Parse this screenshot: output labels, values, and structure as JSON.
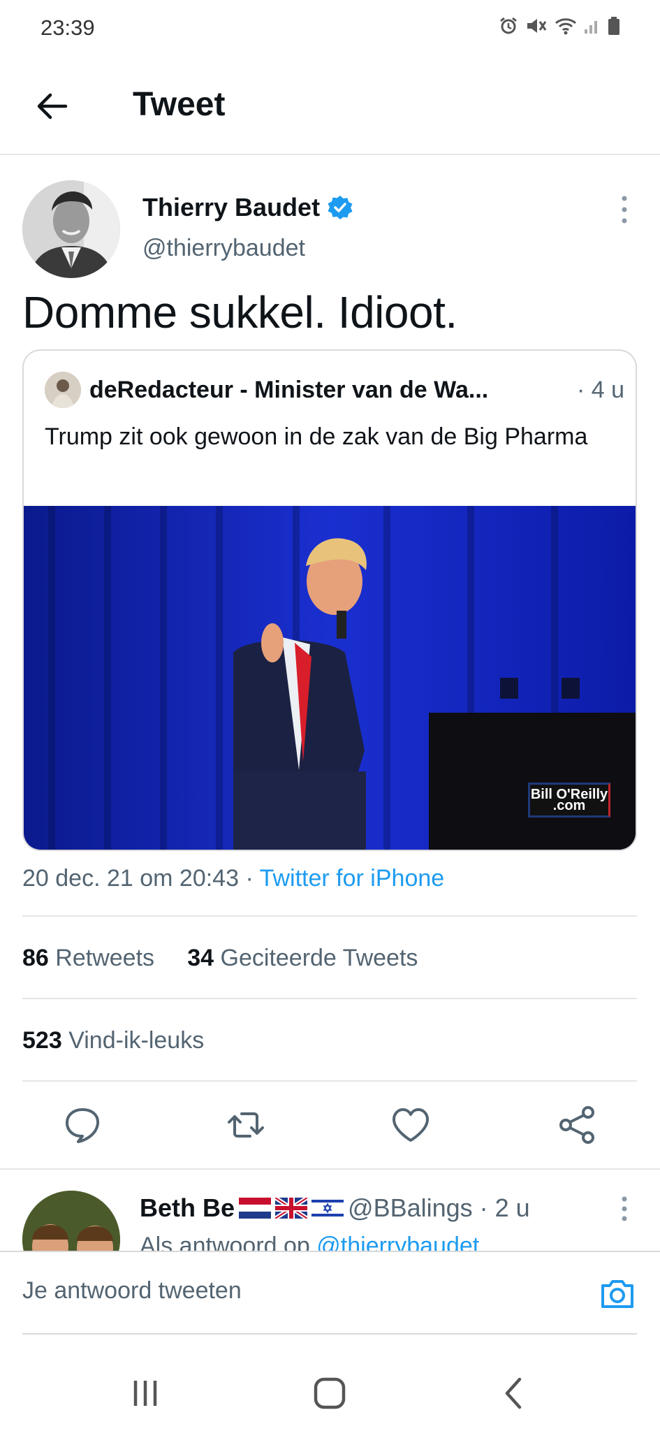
{
  "status_bar": {
    "time": "23:39"
  },
  "header": {
    "title": "Tweet"
  },
  "tweet": {
    "author_name": "Thierry Baudet",
    "author_handle": "@thierrybaudet",
    "text": "Domme sukkel. Idioot.",
    "quote": {
      "author": "deRedacteur - Minister van de Wa...",
      "time": "· 4 u",
      "text": "Trump zit ook gewoon in de zak van de Big Pharma",
      "watermark": "Bill O'Reilly .com"
    },
    "timestamp": "20 dec. 21 om 20:43 · ",
    "source": "Twitter for iPhone",
    "retweets_count": "86",
    "retweets_label": "Retweets",
    "quotes_count": "34",
    "quotes_label": "Geciteerde Tweets",
    "likes_count": "523",
    "likes_label": "Vind-ik-leuks"
  },
  "reply": {
    "name": "Beth Be",
    "handle": "@BBalings · 2 u",
    "reply_prefix": "Als antwoord op ",
    "reply_to": "@thierrybaudet"
  },
  "compose": {
    "placeholder": "Je antwoord tweeten"
  },
  "colors": {
    "accent": "#1d9bf0",
    "text": "#0f1419",
    "muted": "#536471",
    "divider": "#e6e6e6"
  },
  "icons": [
    "arrow-left-icon",
    "verified-icon",
    "more-vertical-icon",
    "reply-icon",
    "retweet-icon",
    "like-icon",
    "share-icon",
    "camera-icon"
  ]
}
